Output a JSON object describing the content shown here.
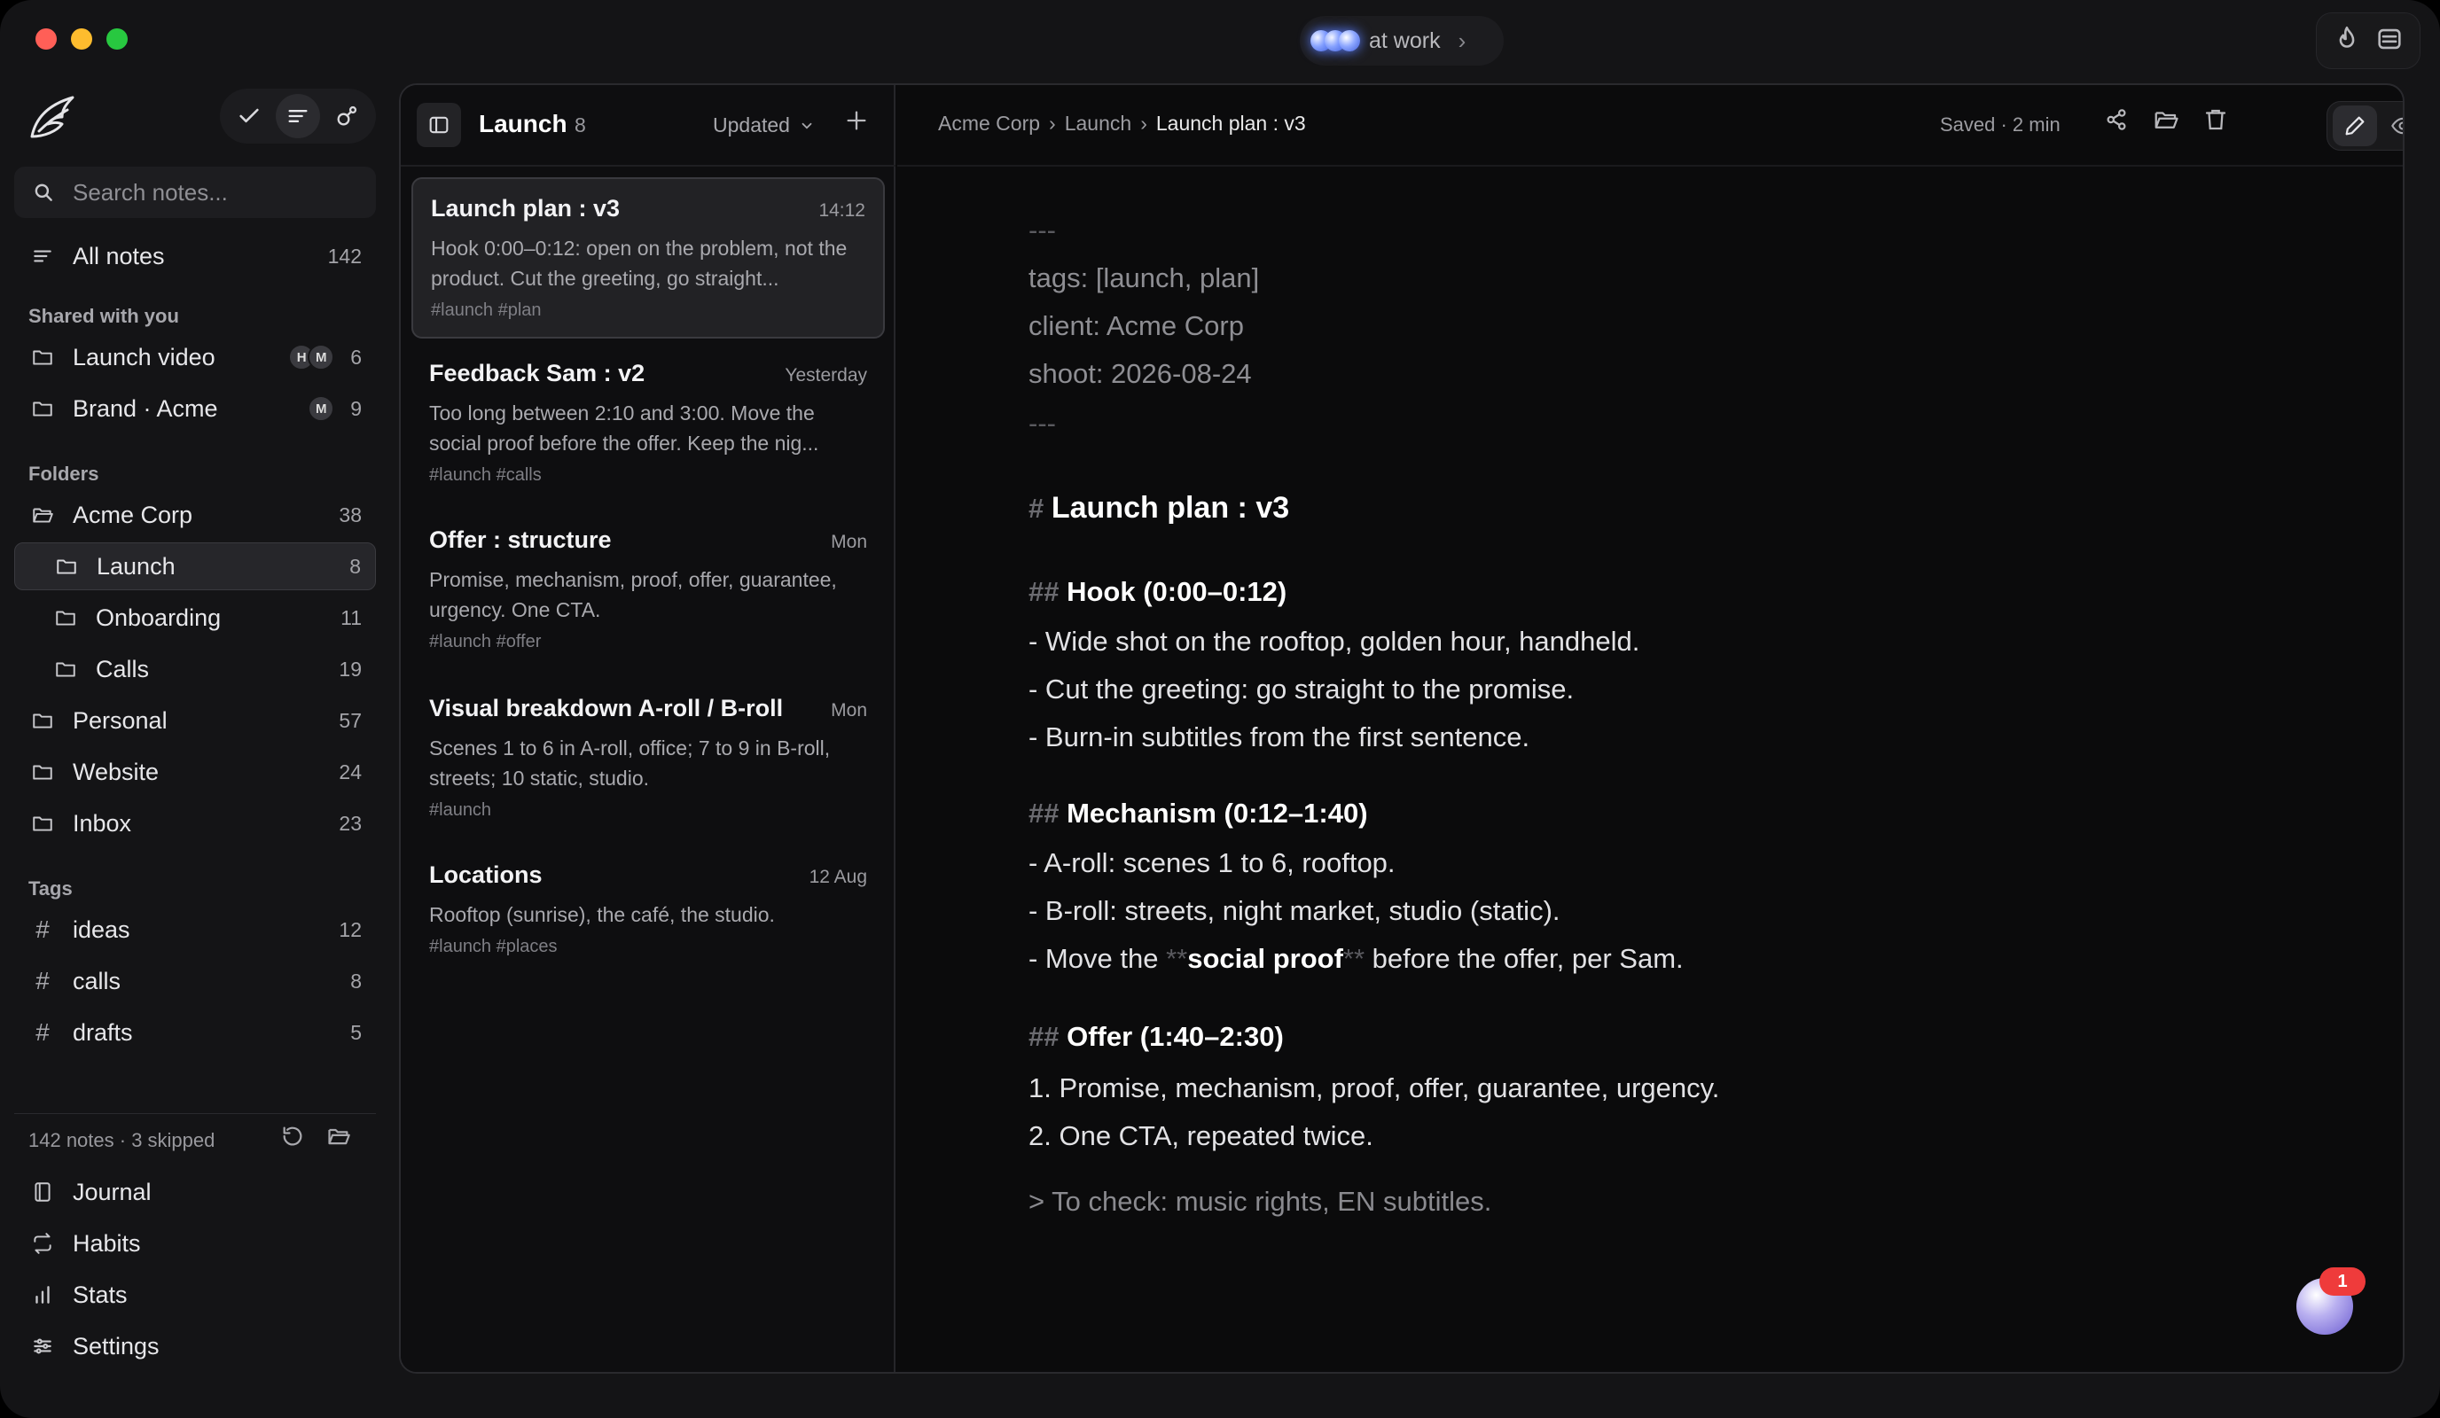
{
  "status": {
    "label": "at work"
  },
  "sidebar": {
    "search_placeholder": "Search notes...",
    "all_notes": {
      "label": "All notes",
      "count": "142"
    },
    "shared_title": "Shared with you",
    "shared": [
      {
        "label": "Launch video",
        "count": "6",
        "avatars": [
          "H",
          "M"
        ]
      },
      {
        "label": "Brand · Acme",
        "count": "9",
        "avatars": [
          "M"
        ]
      }
    ],
    "folders_title": "Folders",
    "folders": [
      {
        "label": "Acme Corp",
        "count": "38"
      },
      {
        "label": "Launch",
        "count": "8"
      },
      {
        "label": "Onboarding",
        "count": "11"
      },
      {
        "label": "Calls",
        "count": "19"
      },
      {
        "label": "Personal",
        "count": "57"
      },
      {
        "label": "Website",
        "count": "24"
      },
      {
        "label": "Inbox",
        "count": "23"
      }
    ],
    "tags_title": "Tags",
    "tags": [
      {
        "label": "ideas",
        "count": "12"
      },
      {
        "label": "calls",
        "count": "8"
      },
      {
        "label": "drafts",
        "count": "5"
      }
    ],
    "footer_stat": "142 notes · 3 skipped",
    "bottom": [
      {
        "label": "Journal"
      },
      {
        "label": "Habits"
      },
      {
        "label": "Stats"
      },
      {
        "label": "Settings"
      }
    ]
  },
  "list": {
    "title": "Launch",
    "count": "8",
    "sort": "Updated",
    "notes": [
      {
        "title": "Launch plan : v3",
        "time": "14:12",
        "preview": "Hook 0:00–0:12: open on the problem, not the product. Cut the greeting, go straight...",
        "tags": "#launch #plan"
      },
      {
        "title": "Feedback Sam : v2",
        "time": "Yesterday",
        "preview": "Too long between 2:10 and 3:00. Move the social proof before the offer. Keep the nig...",
        "tags": "#launch #calls"
      },
      {
        "title": "Offer : structure",
        "time": "Mon",
        "preview": "Promise, mechanism, proof, offer, guarantee, urgency. One CTA.",
        "tags": "#launch #offer"
      },
      {
        "title": "Visual breakdown A-roll / B-roll",
        "time": "Mon",
        "preview": "Scenes 1 to 6 in A-roll, office; 7 to 9 in B-roll, streets; 10 static, studio.",
        "tags": "#launch"
      },
      {
        "title": "Locations",
        "time": "12 Aug",
        "preview": "Rooftop (sunrise), the café, the studio.",
        "tags": "#launch #places"
      }
    ]
  },
  "editor": {
    "breadcrumb": [
      "Acme Corp",
      "Launch",
      "Launch plan : v3"
    ],
    "breadcrumb_sep": "›",
    "saved": "Saved · 2 min",
    "fm_open": "---",
    "fm_tags": "tags: [launch, plan]",
    "fm_client": "client: Acme Corp",
    "fm_shoot": "shoot: 2026-08-24",
    "fm_close": "---",
    "h1_mark": "#",
    "h1": "Launch plan : v3",
    "h2_mark": "##",
    "hook_title": "Hook (0:00–0:12)",
    "hook_1": "- Wide shot on the rooftop, golden hour, handheld.",
    "hook_2": "- Cut the greeting: go straight to the promise.",
    "hook_3": "- Burn-in subtitles from the first sentence.",
    "mech_title": "Mechanism (0:12–1:40)",
    "mech_1": "- A-roll: scenes 1 to 6, rooftop.",
    "mech_2": "- B-roll: streets, night market, studio (static).",
    "mech_3_pre": "- Move the ",
    "mech_3_star": "**",
    "mech_3_bold": "social proof",
    "mech_3_post": " before the offer, per Sam.",
    "offer_title": "Offer (1:40–2:30)",
    "offer_1": "1. Promise, mechanism, proof, offer, guarantee, urgency.",
    "offer_2": "2. One CTA, repeated twice.",
    "quote": "> To check: music rights, EN subtitles."
  },
  "fab": {
    "badge": "1"
  }
}
